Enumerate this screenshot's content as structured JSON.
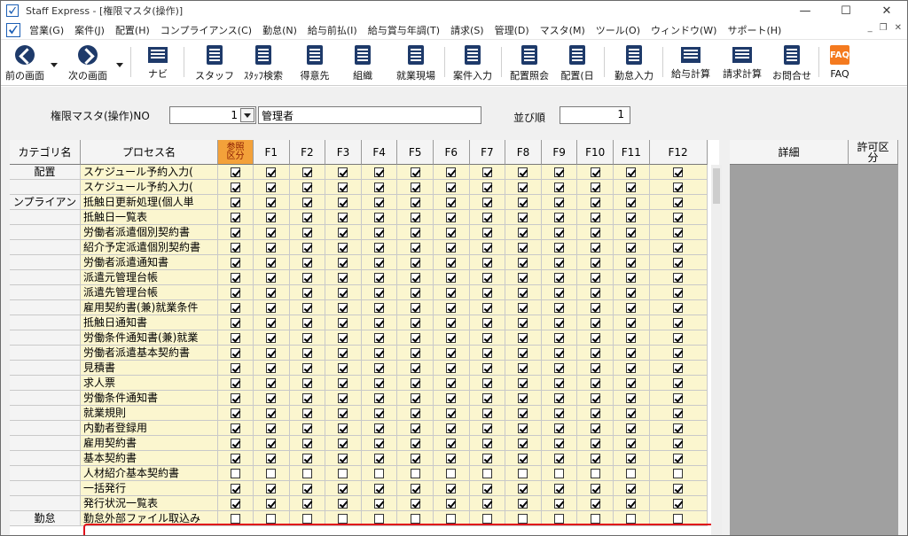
{
  "window": {
    "title": "Staff Express - [権限マスタ(操作)]",
    "minimize": "—",
    "maximize": "☐",
    "close": "✕"
  },
  "menu": {
    "items": [
      "営業(G)",
      "案件(J)",
      "配置(H)",
      "コンプライアンス(C)",
      "勤怠(N)",
      "給与前払(I)",
      "給与賞与年調(T)",
      "請求(S)",
      "管理(D)",
      "マスタ(M)",
      "ツール(O)",
      "ウィンドウ(W)",
      "サポート(H)"
    ],
    "mdi_minimize": "_",
    "mdi_restore": "❐",
    "mdi_close": "✕"
  },
  "toolbar": {
    "back": "前の画面",
    "forward": "次の画面",
    "navi": "ナビ",
    "staff": "スタッフ",
    "staff_search": "ｽﾀｯﾌ検索",
    "customer": "得意先",
    "org": "組織",
    "worksite": "就業現場",
    "case_entry": "案件入力",
    "assign_ref": "配置照会",
    "assign_day": "配置(日",
    "attendance_entry": "勤怠入力",
    "payroll_calc": "給与計算",
    "billing_calc": "請求計算",
    "inquiry": "お問合せ",
    "faq": "FAQ",
    "faq_icon_text": "FAQ"
  },
  "form": {
    "no_label": "権限マスタ(操作)NO",
    "no_value": "1",
    "name_value": "管理者",
    "order_label": "並び順",
    "order_value": "1"
  },
  "grid": {
    "headers": {
      "category": "カテゴリ名",
      "process": "プロセス名",
      "ref_line1": "参照",
      "ref_line2": "区分",
      "f": [
        "F1",
        "F2",
        "F3",
        "F4",
        "F5",
        "F6",
        "F7",
        "F8",
        "F9",
        "F10",
        "F11",
        "F12"
      ]
    },
    "rows": [
      {
        "cat": "配置",
        "proc": "スケジュール予約入力(",
        "on": true
      },
      {
        "cat": "",
        "proc": "スケジュール予約入力(",
        "on": true
      },
      {
        "cat": "ンプライアン",
        "proc": "抵触日更新処理(個人単",
        "on": true
      },
      {
        "cat": "",
        "proc": "抵触日一覧表",
        "on": true
      },
      {
        "cat": "",
        "proc": "労働者派遣個別契約書",
        "on": true
      },
      {
        "cat": "",
        "proc": "紹介予定派遣個別契約書",
        "on": true
      },
      {
        "cat": "",
        "proc": "労働者派遣通知書",
        "on": true
      },
      {
        "cat": "",
        "proc": "派遣元管理台帳",
        "on": true
      },
      {
        "cat": "",
        "proc": "派遣先管理台帳",
        "on": true
      },
      {
        "cat": "",
        "proc": "雇用契約書(兼)就業条件",
        "on": true
      },
      {
        "cat": "",
        "proc": "抵触日通知書",
        "on": true
      },
      {
        "cat": "",
        "proc": "労働条件通知書(兼)就業",
        "on": true
      },
      {
        "cat": "",
        "proc": "労働者派遣基本契約書",
        "on": true
      },
      {
        "cat": "",
        "proc": "見積書",
        "on": true
      },
      {
        "cat": "",
        "proc": "求人票",
        "on": true
      },
      {
        "cat": "",
        "proc": "労働条件通知書",
        "on": true
      },
      {
        "cat": "",
        "proc": "就業規則",
        "on": true
      },
      {
        "cat": "",
        "proc": "内勤者登録用",
        "on": true
      },
      {
        "cat": "",
        "proc": "雇用契約書",
        "on": true
      },
      {
        "cat": "",
        "proc": "基本契約書",
        "on": true
      },
      {
        "cat": "",
        "proc": "人材紹介基本契約書",
        "on": false
      },
      {
        "cat": "",
        "proc": "一括発行",
        "on": true
      },
      {
        "cat": "",
        "proc": "発行状況一覧表",
        "on": true
      },
      {
        "cat": "勤怠",
        "proc": "勤怠外部ファイル取込み",
        "on": false
      }
    ]
  },
  "detail": {
    "detail_header": "詳細",
    "permit_line1": "許可区",
    "permit_line2": "分"
  }
}
